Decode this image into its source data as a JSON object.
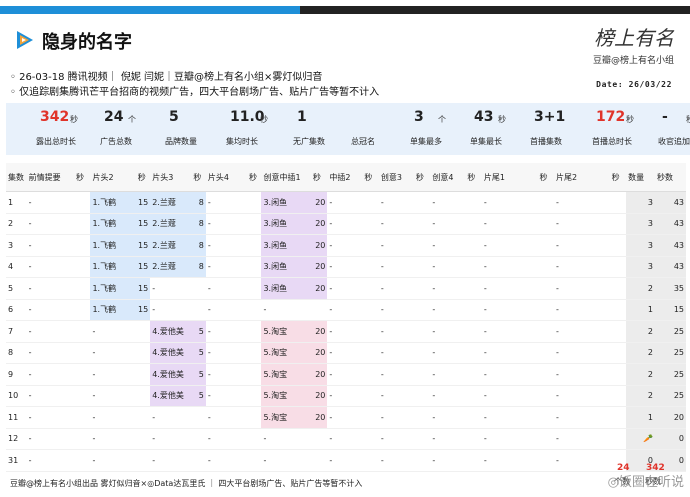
{
  "title": "隐身的名字",
  "brand": {
    "script": "榜上有名",
    "sub": "豆瓣@榜上有名小组"
  },
  "info_line1": "◦ 26-03-18 腾讯视频｜ 倪妮 闫妮｜豆瓣@榜上有名小组×雾灯似归音",
  "info_line2": "◦ 仅追踪剧集腾讯芒平台招商的视频广告，四大平台剧场广告、贴片广告等暂不计入",
  "date": "Date: 26/03/22",
  "summary": [
    {
      "value": "342",
      "unit": "秒",
      "label": "露出总时长",
      "red": true
    },
    {
      "value": "24",
      "unit": "个",
      "label": "广告总数",
      "red": false
    },
    {
      "value": "5",
      "unit": "",
      "label": "品牌数量",
      "red": false
    },
    {
      "value": "11.0",
      "unit": "秒",
      "label": "集均时长",
      "red": false
    },
    {
      "value": "1",
      "unit": "",
      "label": "无广集数",
      "red": false
    },
    {
      "value": "",
      "unit": "",
      "label": "总冠名",
      "red": false
    },
    {
      "value": "3",
      "unit": "个",
      "label": "单集最多",
      "red": false
    },
    {
      "value": "43",
      "unit": "秒",
      "label": "单集最长",
      "red": false
    },
    {
      "value": "3+1",
      "unit": "",
      "label": "首播集数",
      "red": false
    },
    {
      "value": "172",
      "unit": "秒",
      "label": "首播总时长",
      "red": true
    },
    {
      "value": "-",
      "unit": "秒",
      "label": "收官追加",
      "red": false
    }
  ],
  "columns": [
    "集数",
    "前情提要",
    "秒",
    "片头2",
    "秒",
    "片头3",
    "秒",
    "片头4",
    "秒",
    "创意中插1",
    "秒",
    "中插2",
    "秒",
    "创意3",
    "秒",
    "创意4",
    "秒",
    "片尾1",
    "秒",
    "片尾2",
    "秒",
    "数量",
    "秒数"
  ],
  "rows": [
    [
      "1",
      "-",
      "",
      "1.飞鹤",
      "15",
      "2.兰蔻",
      "8",
      "-",
      "",
      "3.闲鱼",
      "20",
      "-",
      "",
      "-",
      "",
      "-",
      "",
      "-",
      "",
      "-",
      "",
      "3",
      "43"
    ],
    [
      "2",
      "-",
      "",
      "1.飞鹤",
      "15",
      "2.兰蔻",
      "8",
      "-",
      "",
      "3.闲鱼",
      "20",
      "-",
      "",
      "-",
      "",
      "-",
      "",
      "-",
      "",
      "-",
      "",
      "3",
      "43"
    ],
    [
      "3",
      "-",
      "",
      "1.飞鹤",
      "15",
      "2.兰蔻",
      "8",
      "-",
      "",
      "3.闲鱼",
      "20",
      "-",
      "",
      "-",
      "",
      "-",
      "",
      "-",
      "",
      "-",
      "",
      "3",
      "43"
    ],
    [
      "4",
      "-",
      "",
      "1.飞鹤",
      "15",
      "2.兰蔻",
      "8",
      "-",
      "",
      "3.闲鱼",
      "20",
      "-",
      "",
      "-",
      "",
      "-",
      "",
      "-",
      "",
      "-",
      "",
      "3",
      "43"
    ],
    [
      "5",
      "-",
      "",
      "1.飞鹤",
      "15",
      "-",
      "",
      "-",
      "",
      "3.闲鱼",
      "20",
      "-",
      "",
      "-",
      "",
      "-",
      "",
      "-",
      "",
      "-",
      "",
      "2",
      "35"
    ],
    [
      "6",
      "-",
      "",
      "1.飞鹤",
      "15",
      "-",
      "",
      "-",
      "",
      "-",
      "",
      "-",
      "",
      "-",
      "",
      "-",
      "",
      "-",
      "",
      "-",
      "",
      "1",
      "15"
    ],
    [
      "7",
      "-",
      "",
      "-",
      "",
      "4.爱他美",
      "5",
      "-",
      "",
      "5.淘宝",
      "20",
      "-",
      "",
      "-",
      "",
      "-",
      "",
      "-",
      "",
      "-",
      "",
      "2",
      "25"
    ],
    [
      "8",
      "-",
      "",
      "-",
      "",
      "4.爱他美",
      "5",
      "-",
      "",
      "5.淘宝",
      "20",
      "-",
      "",
      "-",
      "",
      "-",
      "",
      "-",
      "",
      "-",
      "",
      "2",
      "25"
    ],
    [
      "9",
      "-",
      "",
      "-",
      "",
      "4.爱他美",
      "5",
      "-",
      "",
      "5.淘宝",
      "20",
      "-",
      "",
      "-",
      "",
      "-",
      "",
      "-",
      "",
      "-",
      "",
      "2",
      "25"
    ],
    [
      "10",
      "-",
      "",
      "-",
      "",
      "4.爱他美",
      "5",
      "-",
      "",
      "5.淘宝",
      "20",
      "-",
      "",
      "-",
      "",
      "-",
      "",
      "-",
      "",
      "-",
      "",
      "2",
      "25"
    ],
    [
      "11",
      "-",
      "",
      "-",
      "",
      "-",
      "",
      "-",
      "",
      "5.淘宝",
      "20",
      "-",
      "",
      "-",
      "",
      "-",
      "",
      "-",
      "",
      "-",
      "",
      "1",
      "20"
    ],
    [
      "12",
      "-",
      "",
      "-",
      "",
      "-",
      "",
      "-",
      "",
      "-",
      "",
      "-",
      "",
      "-",
      "",
      "-",
      "",
      "-",
      "",
      "-",
      "",
      "🥕",
      "0"
    ],
    [
      "31",
      "-",
      "",
      "-",
      "",
      "-",
      "",
      "-",
      "",
      "-",
      "",
      "-",
      "",
      "-",
      "",
      "-",
      "",
      "-",
      "",
      "-",
      "",
      "0",
      "0"
    ]
  ],
  "footer": "豆瓣@榜上有名小组出品 雾灯似归音×◎Data达瓦里氏 ｜ 四大平台剧场广告、贴片广告等暂不计入",
  "footer_totals": {
    "count": "24",
    "seconds": "342",
    "count_label": "个数",
    "seconds_label": "秒数"
  },
  "watermark": "◎饭圈在听说",
  "colors": {
    "accent": "#1e8fd8",
    "red": "#e0332a",
    "blue_cell": "#d9e9fb",
    "purple_cell": "#e8d9f5",
    "pink_cell": "#f8dde6"
  }
}
